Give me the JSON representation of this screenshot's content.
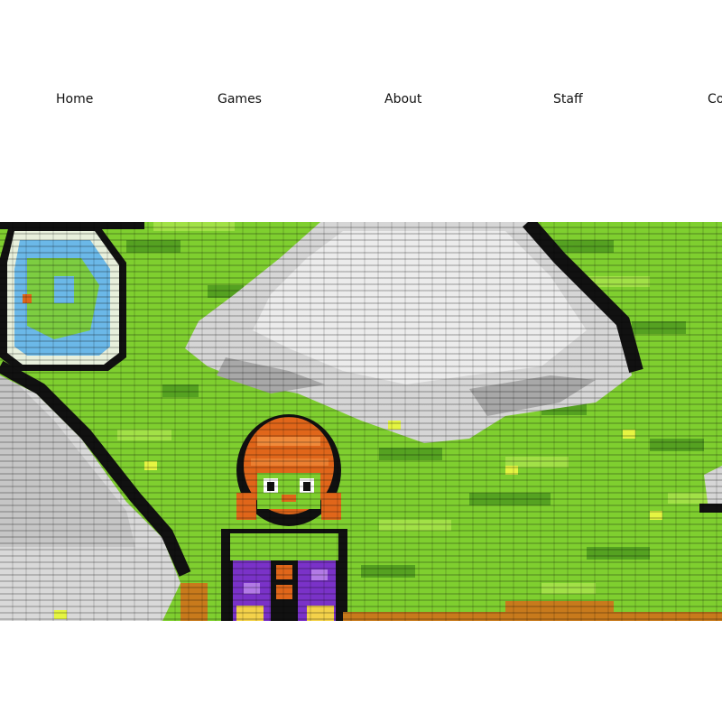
{
  "nav": {
    "items": [
      {
        "label": "Home"
      },
      {
        "label": "Games"
      },
      {
        "label": "About"
      },
      {
        "label": "Staff"
      },
      {
        "label": "Contact"
      }
    ]
  },
  "hero": {
    "image": "pixel-art-game-scene",
    "colors": {
      "grass": "#7fcf2f",
      "grass_dark": "#4e9a1f",
      "grass_light": "#a6e24a",
      "rock_light": "#e6e6e6",
      "rock_mid": "#bdbdbd",
      "outline": "#111111",
      "hair": "#e0661a",
      "robe": "#7a32c8",
      "water": "#6bb8e8",
      "dirt": "#c87a1c"
    }
  }
}
